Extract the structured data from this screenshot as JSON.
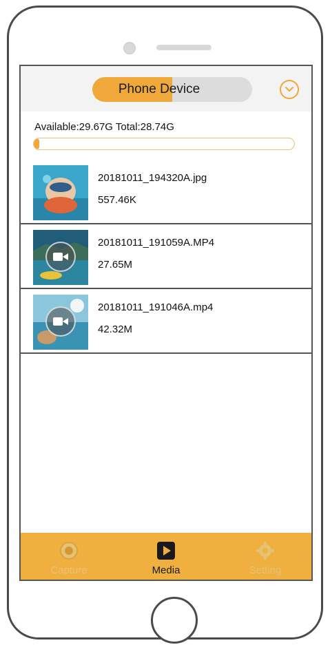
{
  "header": {
    "segment_label": "Phone Device"
  },
  "storage": {
    "text": "Available:29.67G Total:28.74G",
    "used_fraction": 0.02
  },
  "files": [
    {
      "name": "20181011_194320A.jpg",
      "size": "557.46K",
      "type": "photo"
    },
    {
      "name": "20181011_191059A.MP4",
      "size": "27.65M",
      "type": "video"
    },
    {
      "name": "20181011_191046A.mp4",
      "size": "42.32M",
      "type": "video"
    }
  ],
  "tabs": [
    {
      "label": "Capture",
      "icon": "camera-icon",
      "active": false
    },
    {
      "label": "Media",
      "icon": "play-icon",
      "active": true
    },
    {
      "label": "Setting",
      "icon": "gear-icon",
      "active": false
    }
  ],
  "colors": {
    "accent": "#f0a83a",
    "tabbar": "#f0b040",
    "inactive_tab": "#e7c274",
    "active_tab": "#1a1a1a"
  }
}
